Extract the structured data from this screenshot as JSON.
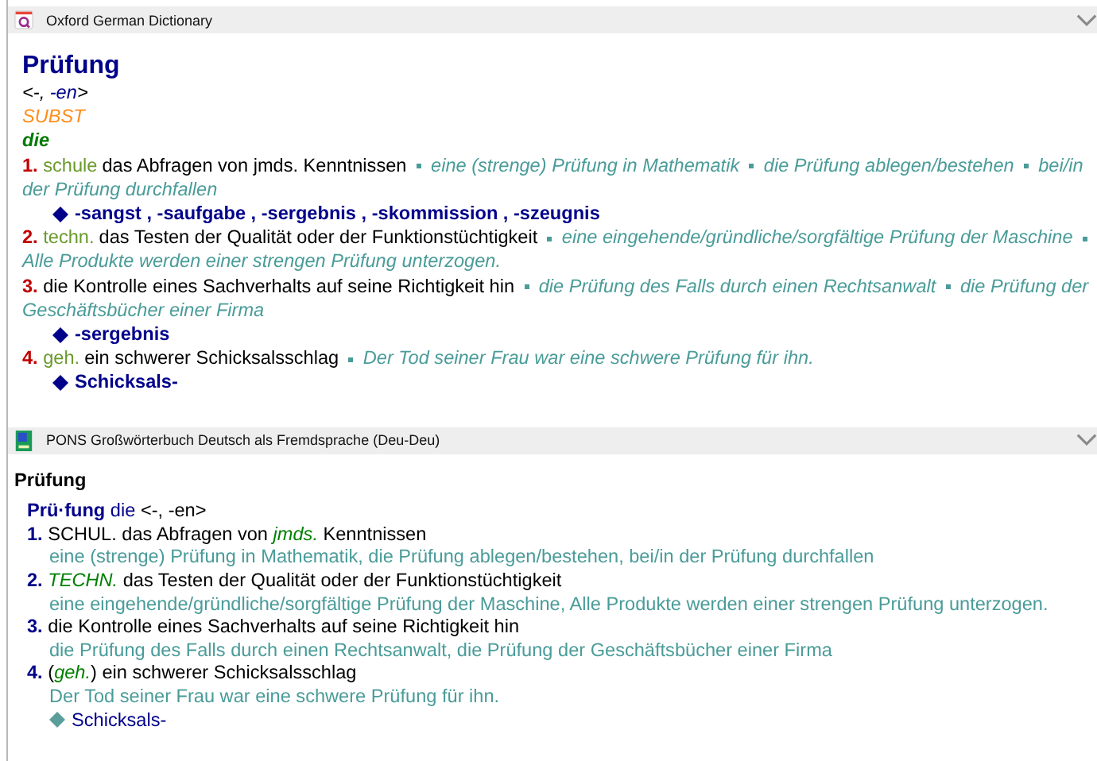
{
  "sections": [
    {
      "kind": "oxford",
      "title": "Oxford German Dictionary",
      "expanded": true,
      "headword": "Prüfung",
      "inflection": {
        "open": "<-, ",
        "forms": "-en",
        "close": ">"
      },
      "pos": "SUBST",
      "gender": "die",
      "senses": [
        {
          "number": "1.",
          "label": "schule",
          "definition": "das Abfragen von jmds. Kenntnissen",
          "examples": [
            "eine (strenge) Prüfung in Mathematik",
            "die Prüfung ablegen/bestehen",
            "bei/in der Prüfung durchfallen"
          ],
          "compounds": "-sangst , -saufgabe , -sergebnis , -skommission , -szeugnis"
        },
        {
          "number": "2.",
          "label": "techn.",
          "definition": "das Testen der Qualität oder der Funktionstüchtigkeit",
          "examples": [
            "eine eingehende/gründliche/sorgfältige Prüfung der Maschine",
            "Alle Produkte werden einer strengen Prüfung unterzogen."
          ]
        },
        {
          "number": "3.",
          "definition": "die Kontrolle eines Sachverhalts auf seine Richtigkeit hin",
          "examples": [
            "die Prüfung des Falls durch einen Rechtsanwalt",
            "die Prüfung der Geschäftsbücher einer Firma"
          ],
          "compounds": "-sergebnis"
        },
        {
          "number": "4.",
          "label": "geh.",
          "definition": "ein schwerer Schicksalsschlag",
          "examples": [
            "Der Tod seiner Frau war eine schwere Prüfung für ihn."
          ],
          "compounds": "Schicksals-"
        }
      ]
    },
    {
      "kind": "pons",
      "title": "PONS Großwörterbuch Deutsch als Fremdsprache (Deu-Deu)",
      "expanded": true,
      "heading": "Prüfung",
      "headword": "Prü·fung",
      "gender": "die",
      "inflection": "<-, -en>",
      "senses": [
        {
          "number": "1.",
          "definition": "SCHUL. das Abfragen von *jmds.* Kenntnissen",
          "examples": "eine (strenge) Prüfung in Mathematik, die Prüfung ablegen/bestehen, bei/in der Prüfung durchfallen"
        },
        {
          "number": "2.",
          "definition": "*TECHN.* das Testen der Qualität oder der Funktionstüchtigkeit",
          "examples": "eine eingehende/gründliche/sorgfältige Prüfung der Maschine, Alle Produkte werden einer strengen Prüfung unterzogen."
        },
        {
          "number": "3.",
          "definition": "die Kontrolle eines Sachverhalts auf seine Richtigkeit hin",
          "examples": "die Prüfung des Falls durch einen Rechtsanwalt, die Prüfung der Geschäftsbücher einer Firma"
        },
        {
          "number": "4.",
          "definition": "(*geh.*) ein schwerer Schicksalsschlag",
          "examples": "Der Tod seiner Frau war eine schwere Prüfung für ihn.",
          "compounds": "Schicksals-"
        }
      ]
    }
  ]
}
